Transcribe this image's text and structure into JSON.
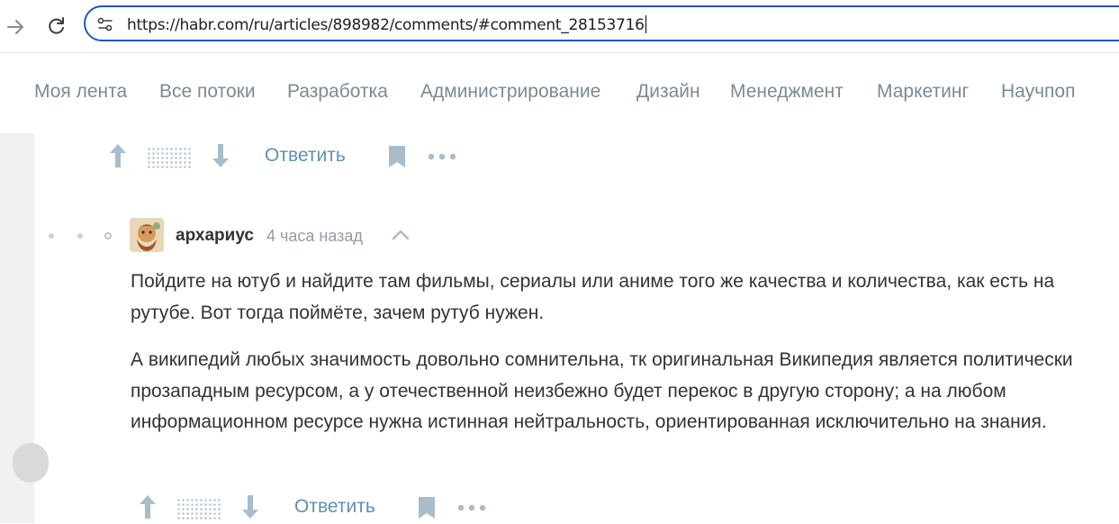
{
  "browser": {
    "url": "https://habr.com/ru/articles/898982/comments/#comment_28153716"
  },
  "nav": {
    "items": [
      "Моя лента",
      "Все потоки",
      "Разработка",
      "Администрирование",
      "Дизайн",
      "Менеджмент",
      "Маркетинг",
      "Научпоп"
    ]
  },
  "comment_prev": {
    "reply_label": "Ответить"
  },
  "comment": {
    "author": "архариус",
    "time": "4 часа назад",
    "paragraphs": [
      "Пойдите на ютуб и найдите там фильмы, сериалы или аниме того же качества и количества, как есть на рутубе. Вот тогда поймёте, зачем рутуб нужен.",
      "А википедий любых значимость довольно сомнительна, тк оригинальная Википедия является политически прозападным ресурсом, а у отечественной неизбежно будет перекос в другую сторону; а на любом информационном ресурсе нужна истинная нейтральность, ориентированная исключительно на знания."
    ],
    "reply_label": "Ответить"
  },
  "colors": {
    "url_border": "#1f57c3",
    "link": "#5e8fb3",
    "icon": "#a9bccb"
  }
}
